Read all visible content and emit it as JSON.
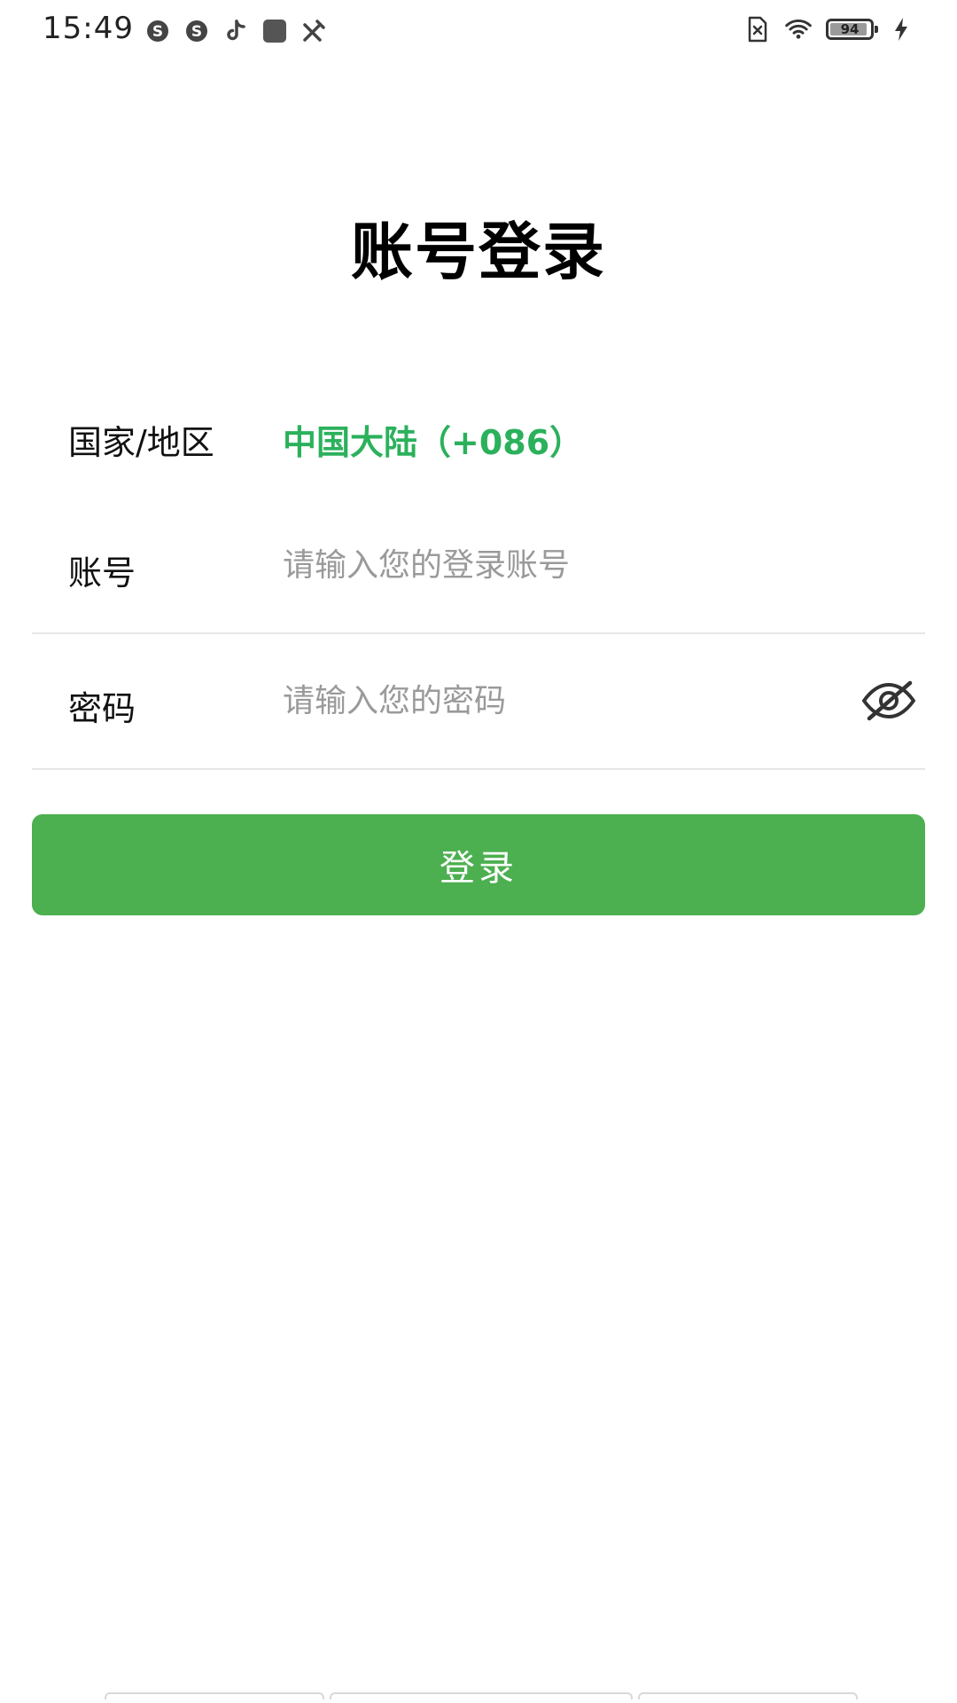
{
  "status_bar": {
    "time": "15:49",
    "battery_level": "94",
    "battery_fraction": 0.94,
    "icons_left": [
      "skype-icon",
      "skype-icon",
      "tiktok-icon",
      "app-square-icon",
      "tools-icon"
    ],
    "icons_right": [
      "sim-off-icon",
      "wifi-icon",
      "battery-icon",
      "charging-icon"
    ]
  },
  "page": {
    "title": "账号登录"
  },
  "form": {
    "country": {
      "label": "国家/地区",
      "value": "中国大陆（+086）"
    },
    "account": {
      "label": "账号",
      "value": "",
      "placeholder": "请输入您的登录账号"
    },
    "password": {
      "label": "密码",
      "value": "",
      "placeholder": "请输入您的密码",
      "toggle_icon": "eye-off-icon"
    }
  },
  "login_button": {
    "label": "登录"
  },
  "colors": {
    "accent_green": "#2bb15c",
    "button_green": "#4caf50",
    "placeholder_gray": "#9a9a9a",
    "divider": "#e6e6e6"
  }
}
